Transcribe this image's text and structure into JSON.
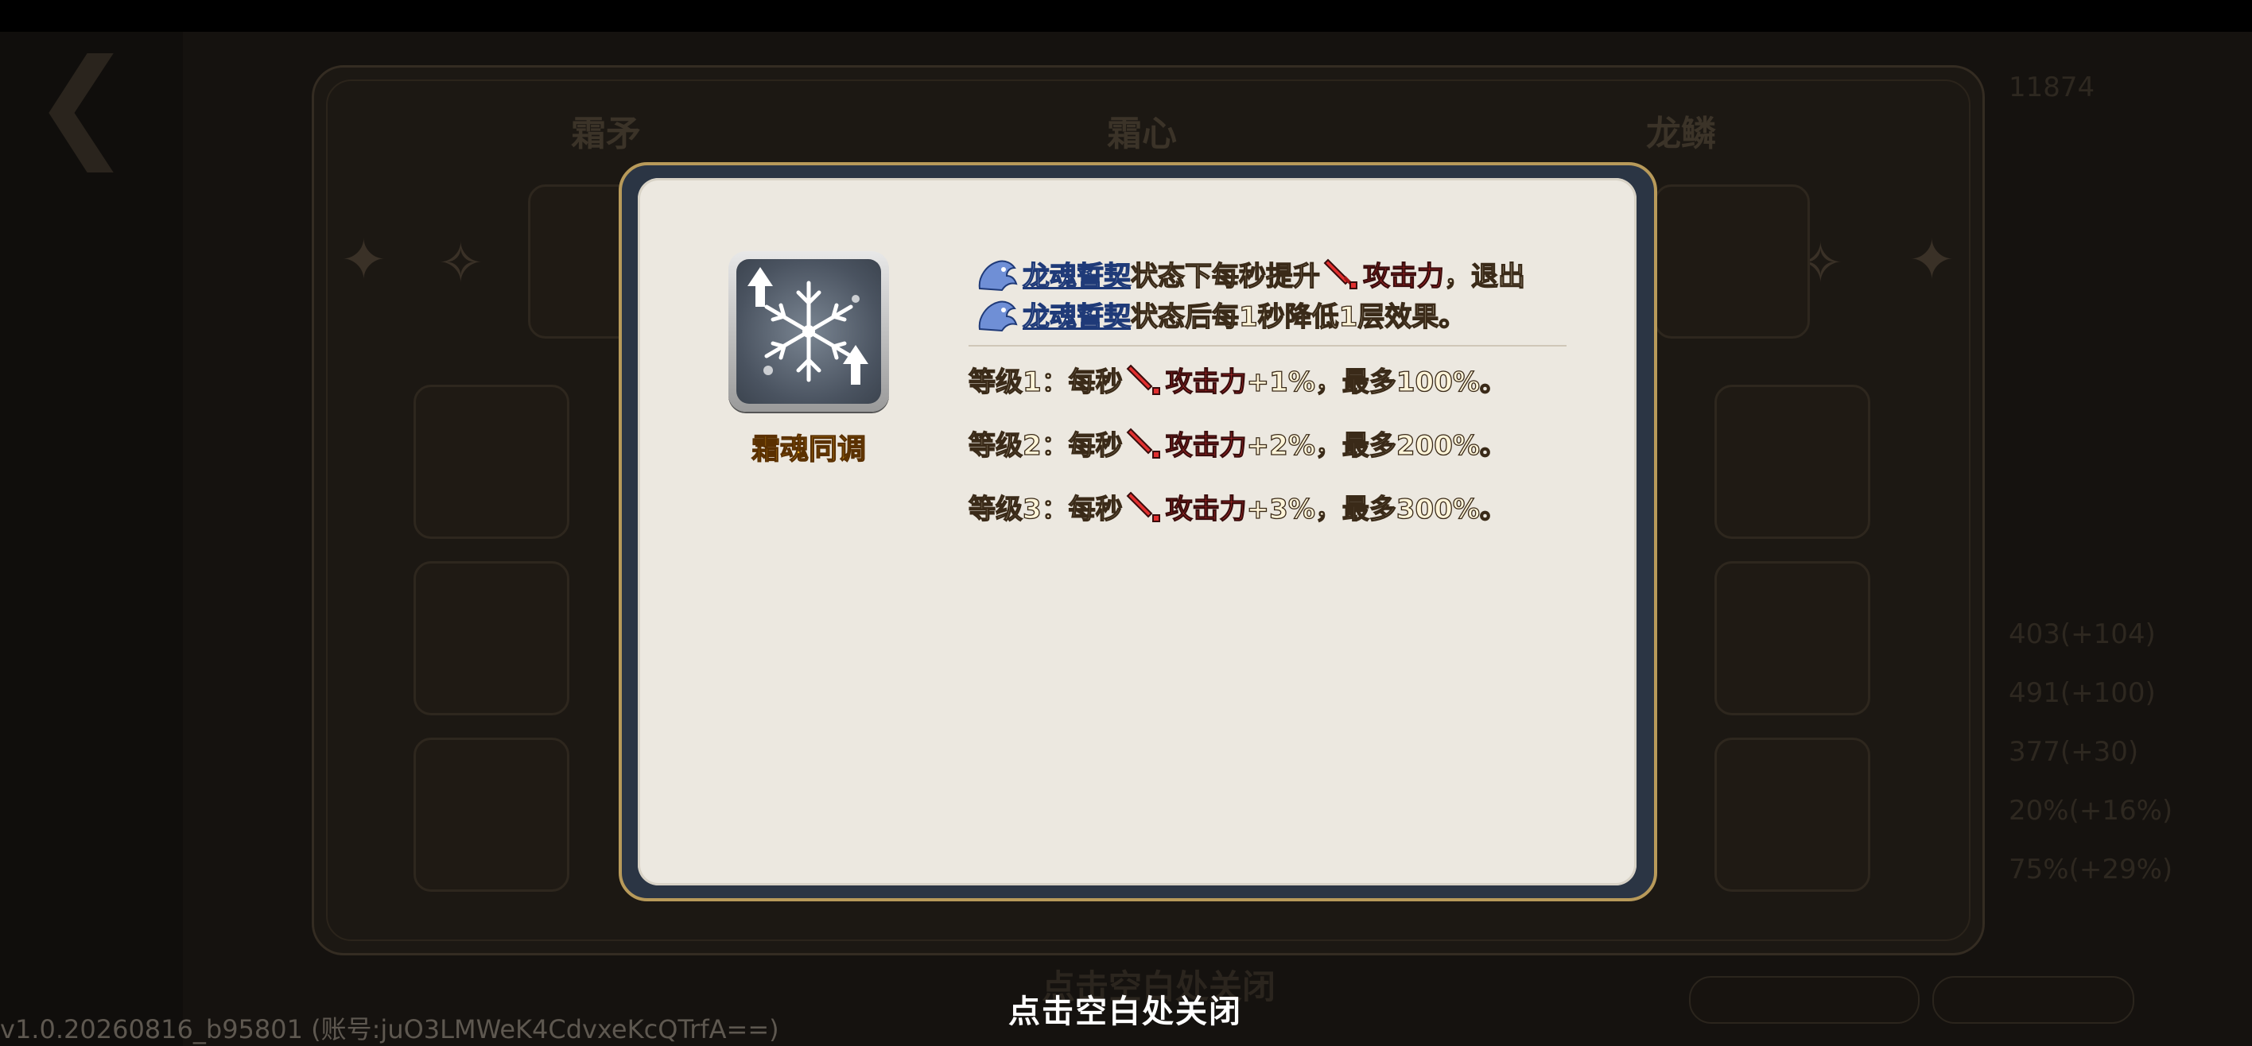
{
  "background": {
    "column_titles": [
      "霜矛",
      "霜心",
      "龙鳞"
    ],
    "side_items": [
      "",
      "",
      ""
    ],
    "right_numbers": [
      "11874",
      "403(+104)",
      "491(+100)",
      "377(+30)",
      "20%(+16%)",
      "75%(+29%)"
    ],
    "bottom_hint_echo": "点击空白处关闭"
  },
  "dialog": {
    "skill_name": "霜魂同调",
    "skill_icon": "snowflake-arrows-icon",
    "desc_line1": {
      "link": "龙魂誓契",
      "text_a": "状态下每秒提升",
      "stat": "攻击力",
      "text_b": "，退出"
    },
    "desc_line2": {
      "link": "龙魂誓契",
      "text_a": "状态后每1秒降低1层效果。"
    },
    "levels": [
      {
        "prefix": "等级1：每秒",
        "stat": "攻击力",
        "suffix": "+1%，最多100%。"
      },
      {
        "prefix": "等级2：每秒",
        "stat": "攻击力",
        "suffix": "+2%，最多200%。"
      },
      {
        "prefix": "等级3：每秒",
        "stat": "攻击力",
        "suffix": "+3%，最多300%。"
      }
    ]
  },
  "close_hint": "点击空白处关闭",
  "version": "v1.0.20260816_b95801 (账号:juO3LMWeK4CdvxeKcQTrfA==)",
  "colors": {
    "dialog_frame": "#2b3544",
    "dialog_border": "#b89a5a",
    "dialog_body": "#ece8e0",
    "skill_name": "#f2b126",
    "stat_red": "#ff3a3a",
    "link_blue": "#1f3a78"
  }
}
